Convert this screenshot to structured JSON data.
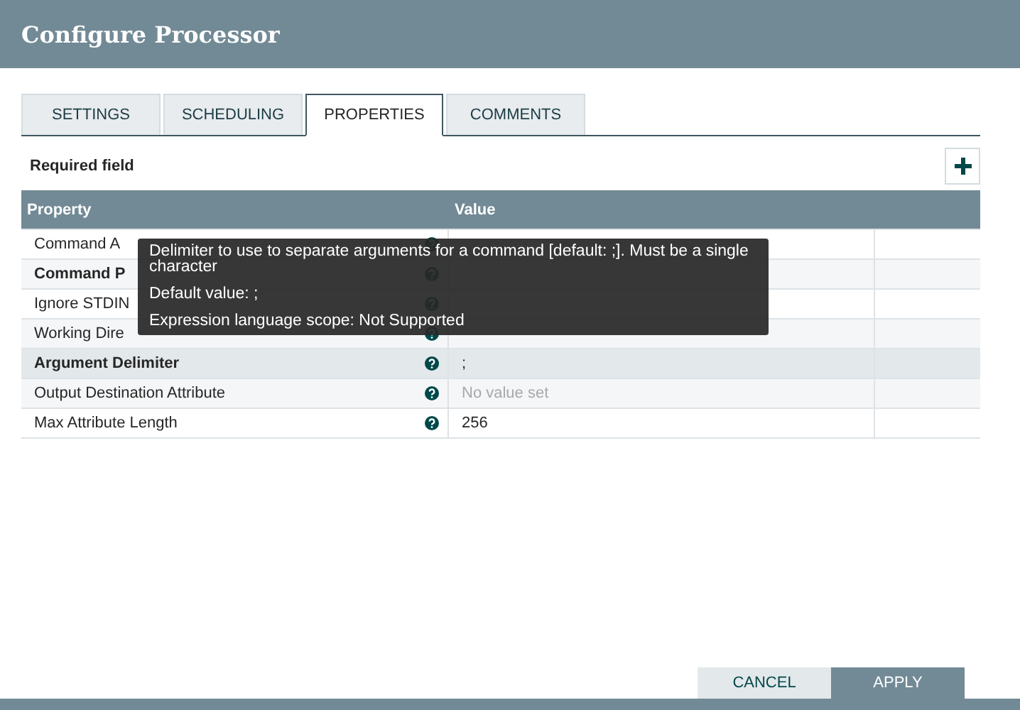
{
  "window": {
    "title": "Configure Processor"
  },
  "tabs": [
    {
      "label": "SETTINGS",
      "selected": false
    },
    {
      "label": "SCHEDULING",
      "selected": false
    },
    {
      "label": "PROPERTIES",
      "selected": true
    },
    {
      "label": "COMMENTS",
      "selected": false
    }
  ],
  "required_note": "Required field",
  "table": {
    "columns": [
      "Property",
      "Value"
    ],
    "rows": [
      {
        "name": "Command A",
        "required": false,
        "selected": false
      },
      {
        "name": "Command P",
        "required": true,
        "selected": false
      },
      {
        "name": "Ignore STDIN",
        "required": false,
        "selected": false
      },
      {
        "name": "Working Dire",
        "required": false,
        "selected": false
      },
      {
        "name": "Argument Delimiter",
        "required": true,
        "selected": true,
        "value": ";"
      },
      {
        "name": "Output Destination Attribute",
        "required": false,
        "selected": false,
        "placeholder": "No value set"
      },
      {
        "name": "Max Attribute Length",
        "required": false,
        "selected": false,
        "value": "256"
      }
    ]
  },
  "tooltip": {
    "description": "Delimiter to use to separate arguments for a command [default: ;]. Must be a single character",
    "default_value": "Default value: ;",
    "scope": "Expression language scope: Not Supported"
  },
  "buttons": [
    {
      "label": "CANCEL",
      "kind": "secondary"
    },
    {
      "label": "APPLY",
      "kind": "primary"
    }
  ]
}
